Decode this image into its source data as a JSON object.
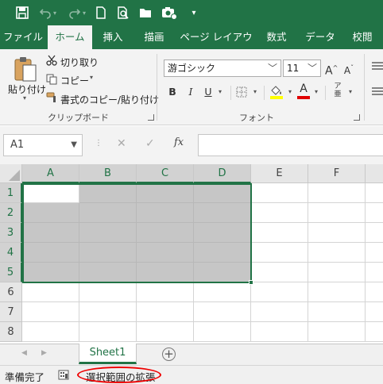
{
  "qat": {
    "icons": [
      "save-icon",
      "undo-icon",
      "redo-icon",
      "new-file-icon",
      "print-preview-icon",
      "open-folder-icon",
      "camera-icon",
      "customize-qat-icon"
    ]
  },
  "tabs": [
    {
      "label": "ファイル",
      "active": false
    },
    {
      "label": "ホーム",
      "active": true
    },
    {
      "label": "挿入",
      "active": false
    },
    {
      "label": "描画",
      "active": false
    },
    {
      "label": "ページ レイアウト",
      "active": false
    },
    {
      "label": "数式",
      "active": false
    },
    {
      "label": "データ",
      "active": false
    },
    {
      "label": "校閲",
      "active": false
    }
  ],
  "ribbon": {
    "clipboard": {
      "paste": "貼り付け",
      "cut": "切り取り",
      "copy": "コピー",
      "format_painter": "書式のコピー/貼り付け",
      "group_label": "クリップボード"
    },
    "font": {
      "font_name": "游ゴシック",
      "font_size": "11",
      "grow": "A",
      "shrink": "A",
      "bold": "B",
      "italic": "I",
      "underline": "U",
      "font_color_letter": "A",
      "phonetic": "ア",
      "group_label": "フォント"
    }
  },
  "formula_bar": {
    "name_box": "A1",
    "fx": "fx",
    "formula": ""
  },
  "grid": {
    "columns": [
      "A",
      "B",
      "C",
      "D",
      "E",
      "F"
    ],
    "rows": [
      "1",
      "2",
      "3",
      "4",
      "5",
      "6",
      "7",
      "8"
    ],
    "selection": "A1:D5",
    "active_cell": "A1"
  },
  "sheets": {
    "tabs": [
      "Sheet1"
    ],
    "add": "+"
  },
  "status": {
    "ready": "準備完了",
    "mode": "選択範囲の拡張"
  },
  "colors": {
    "accent": "#217346",
    "selection": "#c6c6c6",
    "highlight_oval": "#ee0000",
    "font_color_bar": "#e00000",
    "fill_color_bar": "#ffff00"
  }
}
